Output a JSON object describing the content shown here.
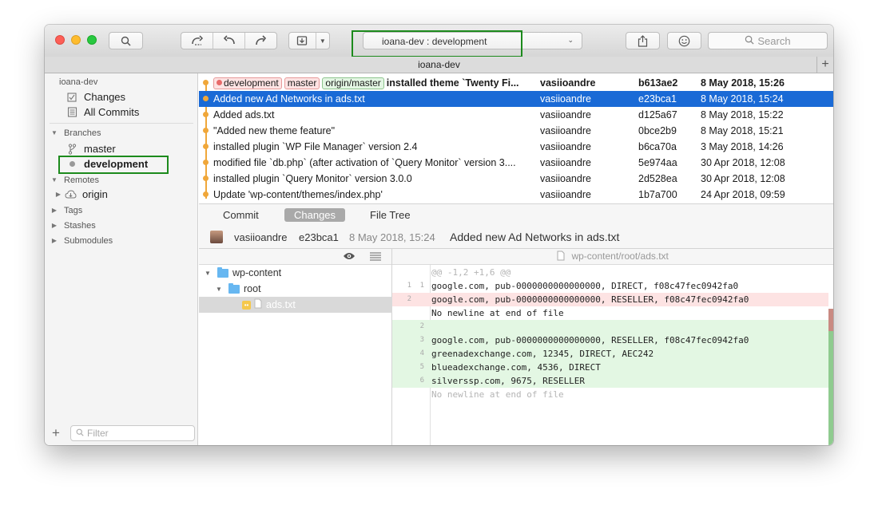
{
  "toolbar": {
    "repo_label": "ioana-dev :  development",
    "search_placeholder": "Search"
  },
  "tabbar": {
    "title": "ioana-dev"
  },
  "sidebar": {
    "repo_name": "ioana-dev",
    "workspace": [
      {
        "label": "Changes",
        "icon": "changes-icon"
      },
      {
        "label": "All Commits",
        "icon": "all-commits-icon"
      }
    ],
    "branches_header": "Branches",
    "branches": [
      {
        "label": "master",
        "icon": "branch-icon",
        "current": false
      },
      {
        "label": "development",
        "icon": "current-branch-dot-icon",
        "current": true
      }
    ],
    "remotes_header": "Remotes",
    "remotes": [
      {
        "label": "origin",
        "icon": "cloud-icon"
      }
    ],
    "tags_header": "Tags",
    "stashes_header": "Stashes",
    "submodules_header": "Submodules",
    "filter_placeholder": "Filter"
  },
  "commits": {
    "head_tags": [
      "development",
      "master",
      "origin/master"
    ],
    "rows": [
      {
        "message": "installed theme `Twenty Fi...",
        "author": "vasiioandre",
        "hash": "b613ae2",
        "date": "8 May 2018, 15:26"
      },
      {
        "message": "Added new Ad Networks in ads.txt",
        "author": "vasiioandre",
        "hash": "e23bca1",
        "date": "8 May 2018, 15:24"
      },
      {
        "message": "Added ads.txt",
        "author": "vasiioandre",
        "hash": "d125a67",
        "date": "8 May 2018, 15:22"
      },
      {
        "message": "\"Added new theme feature\"",
        "author": "vasiioandre",
        "hash": "0bce2b9",
        "date": "8 May 2018, 15:21"
      },
      {
        "message": "installed plugin `WP File Manager` version 2.4",
        "author": "vasiioandre",
        "hash": "b6ca70a",
        "date": "3 May 2018, 14:26"
      },
      {
        "message": "modified file `db.php` (after activation of `Query Monitor` version 3....",
        "author": "vasiioandre",
        "hash": "5e974aa",
        "date": "30 Apr 2018, 12:08"
      },
      {
        "message": "installed plugin `Query Monitor` version 3.0.0",
        "author": "vasiioandre",
        "hash": "2d528ea",
        "date": "30 Apr 2018, 12:08"
      },
      {
        "message": "Update 'wp-content/themes/index.php'",
        "author": "vasiioandre",
        "hash": "1b7a700",
        "date": "24 Apr 2018, 09:59"
      }
    ]
  },
  "detail_tabs": [
    "Commit",
    "Changes",
    "File Tree"
  ],
  "summary": {
    "author": "vasiioandre",
    "hash": "e23bca1",
    "date": "8 May 2018, 15:24",
    "message": "Added new Ad Networks in ads.txt"
  },
  "filetree": {
    "items": [
      {
        "label": "wp-content",
        "type": "folder"
      },
      {
        "label": "root",
        "type": "folder"
      },
      {
        "label": "ads.txt",
        "type": "file"
      }
    ]
  },
  "diff": {
    "file_path": "wp-content/root/ads.txt",
    "lines": [
      {
        "type": "meta",
        "old": "",
        "new": "",
        "text": "@@ -1,2 +1,6 @@"
      },
      {
        "type": "ctx",
        "old": "1",
        "new": "1",
        "text": "google.com, pub-0000000000000000, DIRECT, f08c47fec0942fa0"
      },
      {
        "type": "del",
        "old": "2",
        "new": "",
        "text": "google.com, pub-0000000000000000, RESELLER, f08c47fec0942fa0"
      },
      {
        "type": "del-note",
        "old": "",
        "new": "",
        "text": "No newline at end of file"
      },
      {
        "type": "add",
        "old": "",
        "new": "2",
        "text": ""
      },
      {
        "type": "add",
        "old": "",
        "new": "3",
        "text": "google.com, pub-0000000000000000, RESELLER, f08c47fec0942fa0"
      },
      {
        "type": "add",
        "old": "",
        "new": "4",
        "text": "greenadexchange.com, 12345, DIRECT, AEC242"
      },
      {
        "type": "add",
        "old": "",
        "new": "5",
        "text": "blueadexchange.com, 4536, DIRECT"
      },
      {
        "type": "add",
        "old": "",
        "new": "6",
        "text": "silverssp.com, 9675, RESELLER"
      },
      {
        "type": "meta",
        "old": "",
        "new": "",
        "text": "No newline at end of file"
      }
    ]
  },
  "colors": {
    "selection": "#1a6ad6",
    "graph": "#f0a73a",
    "highlight_box": "#1c8a1c",
    "added": "#e3f7e3",
    "removed": "#fde3e3"
  }
}
